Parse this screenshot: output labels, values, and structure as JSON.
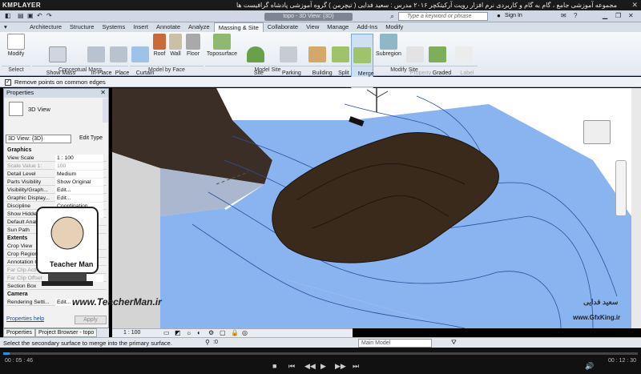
{
  "player": {
    "logo": "KMPLAYER",
    "title": "مجموعه آموزشی جامع ، گام به گام و کاربردی نرم افزار رویت آرکیتکچر ۲۰۱۶  مدرس : سعید فدایی ( تیچرمن ) گروه آموزشی پادشاه گرافیست ها",
    "close": "✕",
    "time_current": "00 : 05 : 46",
    "time_total": "00 : 12 : 30",
    "progress": 0.01
  },
  "revit": {
    "window_title": "topo - 3D View: {3D}",
    "search_placeholder": "Type a keyword or phrase",
    "signin": "Sign In",
    "tabs": [
      "Architecture",
      "Structure",
      "Systems",
      "Insert",
      "Annotate",
      "Analyze",
      "Massing & Site",
      "Collaborate",
      "View",
      "Manage",
      "Add-Ins",
      "Modify"
    ],
    "active_tab": "Massing & Site",
    "ribbon": {
      "modify": "Modify",
      "show_mass": "Show Mass\nby View Settings",
      "in_place_mass": "In-Place\nMass",
      "place_mass": "Place\nMass",
      "curtain_system": "Curtain\nSystem",
      "roof": "Roof",
      "wall": "Wall",
      "floor": "Floor",
      "toposurface": "Toposurface",
      "site_component": "Site\nComponent",
      "parking_component": "Parking\nComponent",
      "building_pad": "Building\nPad",
      "split_surface": "Split\nSurface",
      "merge_surfaces": "Merge\nSurfaces",
      "subregion": "Subregion",
      "property_line": "Property\nLine",
      "graded_region": "Graded\nRegion",
      "label_contours": "Label\nContours"
    },
    "panels": [
      "Select",
      "Conceptual Mass",
      "Model by Face",
      "Model Site",
      "Modify Site"
    ],
    "options": {
      "remove_points": "Remove points on common edges",
      "checked": true
    },
    "properties": {
      "header": "Properties",
      "type_name": "3D View",
      "view_select": "3D View: {3D}",
      "edit_type": "Edit Type",
      "rows": [
        {
          "group": "Graphics"
        },
        {
          "k": "View Scale",
          "v": "1 : 100"
        },
        {
          "k": "Scale Value  1:",
          "v": "100",
          "disabled": true
        },
        {
          "k": "Detail Level",
          "v": "Medium"
        },
        {
          "k": "Parts Visibility",
          "v": "Show Original"
        },
        {
          "k": "Visibility/Graph...",
          "v": "Edit..."
        },
        {
          "k": "Graphic Display...",
          "v": "Edit..."
        },
        {
          "k": "Discipline",
          "v": "Coordination"
        },
        {
          "k": "Show Hidden Li...",
          "v": "By Discipline"
        },
        {
          "k": "Default Anal...",
          "v": ""
        },
        {
          "k": "Sun Path",
          "v": ""
        },
        {
          "group": "Extents"
        },
        {
          "k": "Crop View",
          "v": ""
        },
        {
          "k": "Crop Region...",
          "v": ""
        },
        {
          "k": "Annotation C...",
          "v": ""
        },
        {
          "k": "Far Clip Active",
          "v": "",
          "disabled": true
        },
        {
          "k": "Far Clip Offset",
          "v": "304.8",
          "disabled": true
        },
        {
          "k": "Section Box",
          "v": ""
        },
        {
          "group": "Camera"
        },
        {
          "k": "Rendering Setti...",
          "v": "Edit..."
        }
      ],
      "help": "Properties help",
      "apply": "Apply"
    },
    "palette_tabs": [
      "Properties",
      "Project Browser - topo"
    ],
    "view_scale": "1 : 100",
    "status": "Select the secondary surface to merge into the primary surface.",
    "status_zero": ":0",
    "main_model": "Main Model"
  },
  "watermarks": {
    "teacherman_url": "www.TeacherMan.ir",
    "teacherman_title": "Teacher Man",
    "gfxking_url": "www.GfxKing.ir",
    "gfxking_name": "سعید فدایی"
  },
  "colors": {
    "topo_blue": "#8ab4f0",
    "dark_region": "#3a2a1c",
    "ribbon_bg": "#e8edf3"
  }
}
